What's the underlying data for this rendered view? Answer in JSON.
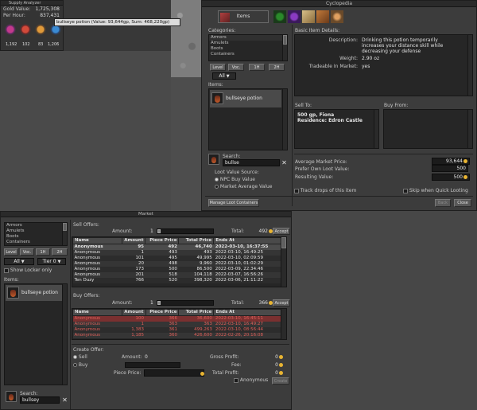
{
  "supply": {
    "title": "Supply Analyzer",
    "gold_label": "Gold Value:",
    "gold_value": "1,725,308",
    "hour_label": "Per Hour:",
    "hour_value": "837,431",
    "counts": [
      "1,192",
      "102",
      "83",
      "1,206"
    ]
  },
  "tooltip": "bullseye potion (Value: 93,644gp, Sum: 468,220gp)",
  "cyclopedia": {
    "title": "Cyclopedia",
    "items_tab": "Items",
    "categories_label": "Categories:",
    "categories": [
      "Armors",
      "Amulets",
      "Boots",
      "Containers"
    ],
    "level_btn": "Level",
    "voc_btn": "Voc.",
    "onehand_btn": "1H",
    "twohand_btn": "2H",
    "filter_value": "All",
    "items_label": "Items:",
    "item_name": "bullseye potion",
    "search_label": "Search:",
    "search_value": "bullse",
    "loot_source_label": "Loot Value Source:",
    "npc_option": "NPC Buy Value",
    "market_option": "Market Average Value",
    "manage_btn": "Manage Loot Containers",
    "details_label": "Basic Item Details:",
    "desc_label": "Description:",
    "desc_value": "Drinking this potion temporarily increases your distance skill while decreasing your defense",
    "weight_label": "Weight:",
    "weight_value": "2.90 oz",
    "tradeable_label": "Tradeable In Market:",
    "tradeable_value": "yes",
    "sell_to_label": "Sell To:",
    "sell_to_line1": "500 gp, Fiona",
    "sell_to_line2": "Residence: Edron Castle",
    "buy_from_label": "Buy From:",
    "avg_label": "Average Market Price:",
    "avg_value": "93,644",
    "prefer_label": "Prefer Own Loot Value:",
    "prefer_value": "500",
    "result_label": "Resulting Value:",
    "result_value": "500",
    "track_label": "Track drops of this item",
    "skip_label": "Skip when Quick Looting",
    "back_btn": "Back",
    "close_btn": "Close"
  },
  "market": {
    "title": "Market",
    "categories": [
      "Armors",
      "Amulets",
      "Boots",
      "Containers"
    ],
    "level_btn": "Level",
    "voc_btn": "Voc.",
    "onehand_btn": "1H",
    "twohand_btn": "2H",
    "filter_value": "All",
    "tier_value": "Tier 0",
    "show_locker": "Show Locker only",
    "items_label": "Items:",
    "item_name": "bullseye potion",
    "search_label": "Search:",
    "search_value": "bullsey",
    "sell_offers_label": "Sell Offers:",
    "buy_offers_label": "Buy Offers:",
    "amount_label": "Amount:",
    "amount_value": "1",
    "total_label": "Total:",
    "sell_total": "492",
    "buy_total": "366",
    "accept_btn": "Accept",
    "columns": [
      "Name",
      "Amount",
      "Piece Price",
      "Total Price",
      "Ends At"
    ],
    "sell_rows": [
      [
        "Anonymous",
        "95",
        "492",
        "46,740",
        "2022-03-10, 16:37:55"
      ],
      [
        "Anonymous",
        "1",
        "493",
        "493",
        "2022-03-10, 16:49:25"
      ],
      [
        "Anonymous",
        "101",
        "495",
        "49,995",
        "2022-03-10, 02:09:59"
      ],
      [
        "Anonymous",
        "20",
        "498",
        "9,960",
        "2022-03-10, 01:02:29"
      ],
      [
        "Anonymous",
        "173",
        "500",
        "86,500",
        "2022-03-09, 22:34:46"
      ],
      [
        "Anonymous",
        "201",
        "518",
        "104,118",
        "2022-03-07, 16:56:26"
      ],
      [
        "Ten Duzy",
        "766",
        "520",
        "398,320",
        "2022-03-06, 21:11:22"
      ]
    ],
    "buy_rows": [
      [
        "Anonymous",
        "100",
        "366",
        "36,600",
        "2022-03-10, 16:45:11"
      ],
      [
        "Anonymous",
        "1",
        "363",
        "363",
        "2022-03-10, 16:49:27"
      ],
      [
        "Anonymous",
        "1,383",
        "361",
        "499,263",
        "2022-03-10, 08:56:44"
      ],
      [
        "Anonymous",
        "1,185",
        "360",
        "426,600",
        "2022-02-26, 20:16:08"
      ]
    ],
    "create_label": "Create Offer:",
    "sell_option": "Sell",
    "buy_option": "Buy",
    "create_amount_label": "Amount:",
    "create_amount_value": "0",
    "piece_label": "Piece Price:",
    "gross_label": "Gross Profit:",
    "gross_value": "0",
    "fee_label": "Fee:",
    "fee_value": "0",
    "total_profit_label": "Total Profit:",
    "total_profit_value": "0",
    "anon_label": "Anonymous",
    "create_btn": "Create"
  },
  "colors": {
    "gold": "#e8b432",
    "buy_text": "#e0605a",
    "panel": "#3c3c3c"
  }
}
